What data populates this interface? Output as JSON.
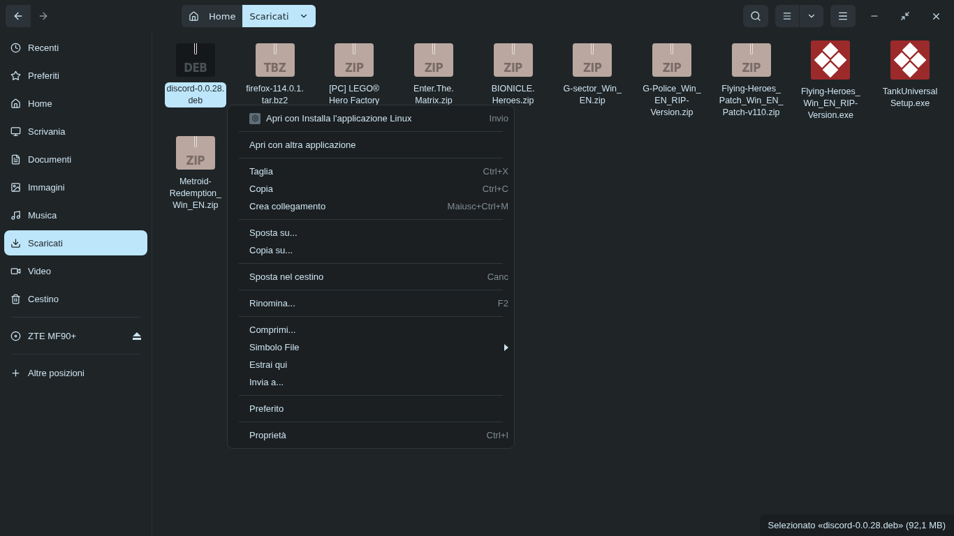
{
  "breadcrumb": [
    {
      "label": "Home",
      "kind": "home",
      "selected": false
    },
    {
      "label": "Scaricati",
      "kind": "folder",
      "selected": true
    }
  ],
  "sidebar": {
    "places": [
      {
        "label": "Recenti",
        "kind": "recent",
        "selected": false
      },
      {
        "label": "Preferiti",
        "kind": "star",
        "selected": false
      },
      {
        "label": "Home",
        "kind": "home",
        "selected": false
      },
      {
        "label": "Scrivania",
        "kind": "desktop",
        "selected": false
      },
      {
        "label": "Documenti",
        "kind": "document",
        "selected": false
      },
      {
        "label": "Immagini",
        "kind": "image",
        "selected": false
      },
      {
        "label": "Musica",
        "kind": "music",
        "selected": false
      },
      {
        "label": "Scaricati",
        "kind": "download",
        "selected": true
      },
      {
        "label": "Video",
        "kind": "video",
        "selected": false
      },
      {
        "label": "Cestino",
        "kind": "trash",
        "selected": false
      }
    ],
    "devices": [
      {
        "label": "ZTE MF90+",
        "kind": "disc",
        "ejectable": true
      }
    ],
    "other": {
      "label": "Altre posizioni"
    }
  },
  "files": [
    {
      "name": "discord-0.0.28.\ndeb",
      "kind": "archive",
      "badge": "DEB",
      "dark": true,
      "selected": true
    },
    {
      "name": "firefox-114.0.1.\ntar.bz2",
      "kind": "archive",
      "badge": "TBZ",
      "dark": false,
      "selected": false
    },
    {
      "name": "[PC] LEGO®\nHero Factory",
      "kind": "archive",
      "badge": "ZIP",
      "dark": false,
      "selected": false
    },
    {
      "name": "Enter.The.\nMatrix.zip",
      "kind": "archive",
      "badge": "ZIP",
      "dark": false,
      "selected": false
    },
    {
      "name": "BIONICLE.\nHeroes.zip",
      "kind": "archive",
      "badge": "ZIP",
      "dark": false,
      "selected": false
    },
    {
      "name": "G-sector_Win_\nEN.zip",
      "kind": "archive",
      "badge": "ZIP",
      "dark": false,
      "selected": false
    },
    {
      "name": "G-Police_Win_\nEN_RIP-\nVersion.zip",
      "kind": "archive",
      "badge": "ZIP",
      "dark": false,
      "selected": false
    },
    {
      "name": "Flying-Heroes_\nPatch_Win_EN_\nPatch-v110.zip",
      "kind": "archive",
      "badge": "ZIP",
      "dark": false,
      "selected": false
    },
    {
      "name": "Flying-Heroes_\nWin_EN_RIP-\nVersion.exe",
      "kind": "exe",
      "selected": false
    },
    {
      "name": "TankUniversal\nSetup.exe",
      "kind": "exe",
      "selected": false
    },
    {
      "name": "Metroid-\nRedemption_\nWin_EN.zip",
      "kind": "archive",
      "badge": "ZIP",
      "dark": false,
      "selected": false
    }
  ],
  "context_menu": [
    [
      {
        "label": "Apri con Installa l'applicazione Linux",
        "shortcut": "Invio",
        "kind": "app"
      }
    ],
    [
      {
        "label": "Apri con altra applicazione",
        "kind": "plain"
      }
    ],
    [
      {
        "label": "Taglia",
        "shortcut": "Ctrl+X",
        "kind": "plain"
      },
      {
        "label": "Copia",
        "shortcut": "Ctrl+C",
        "kind": "plain"
      },
      {
        "label": "Crea collegamento",
        "shortcut": "Maiusc+Ctrl+M",
        "kind": "plain"
      }
    ],
    [
      {
        "label": "Sposta su...",
        "kind": "plain"
      },
      {
        "label": "Copia su...",
        "kind": "plain"
      }
    ],
    [
      {
        "label": "Sposta nel cestino",
        "shortcut": "Canc",
        "kind": "plain"
      }
    ],
    [
      {
        "label": "Rinomina...",
        "shortcut": "F2",
        "kind": "plain"
      }
    ],
    [
      {
        "label": "Comprimi...",
        "kind": "plain"
      },
      {
        "label": "Simbolo File",
        "kind": "submenu"
      },
      {
        "label": "Estrai qui",
        "kind": "plain"
      },
      {
        "label": "Invia a...",
        "kind": "plain"
      }
    ],
    [
      {
        "label": "Preferito",
        "kind": "plain"
      }
    ],
    [
      {
        "label": "Proprietà",
        "shortcut": "Ctrl+I",
        "kind": "plain"
      }
    ]
  ],
  "status_bar": "Selezionato «discord-0.0.28.deb» (92,1 MB)"
}
